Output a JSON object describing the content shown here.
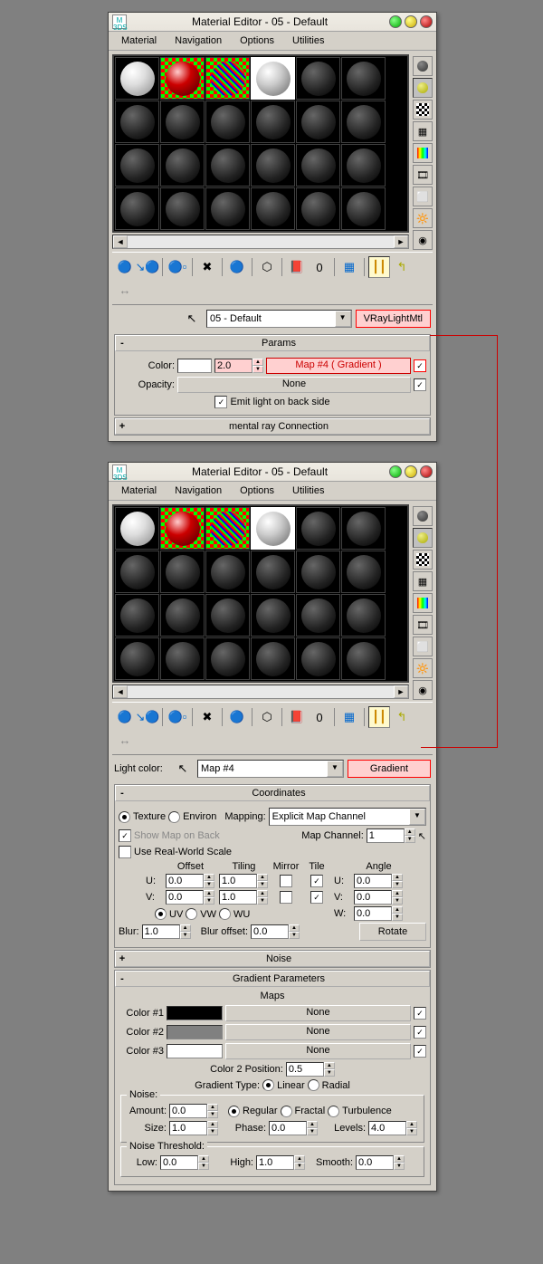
{
  "w1": {
    "title": "Material Editor - 05 - Default",
    "menus": [
      "Material",
      "Navigation",
      "Options",
      "Utilities"
    ],
    "mat_name": "05 - Default",
    "mat_type": "VRayLightMtl",
    "params": {
      "title": "Params",
      "color_lbl": "Color:",
      "intensity": "2.0",
      "map_label": "Map #4  ( Gradient )",
      "opacity_lbl": "Opacity:",
      "opacity_map": "None",
      "emit_label": "Emit light on back side"
    },
    "mray": "mental ray Connection"
  },
  "w2": {
    "title": "Material Editor - 05 - Default",
    "menus": [
      "Material",
      "Navigation",
      "Options",
      "Utilities"
    ],
    "light_color_lbl": "Light color:",
    "map_name": "Map #4",
    "map_type": "Gradient",
    "coords": {
      "title": "Coordinates",
      "texture": "Texture",
      "environ": "Environ",
      "mapping_lbl": "Mapping:",
      "mapping": "Explicit Map Channel",
      "show_map": "Show Map on Back",
      "map_channel_lbl": "Map Channel:",
      "map_channel": "1",
      "real_world": "Use Real-World Scale",
      "hdr_offset": "Offset",
      "hdr_tiling": "Tiling",
      "hdr_mirror": "Mirror",
      "hdr_tile": "Tile",
      "hdr_angle": "Angle",
      "u": "U:",
      "v": "V:",
      "w": "W:",
      "u_off": "0.0",
      "u_til": "1.0",
      "u_ang": "0.0",
      "v_off": "0.0",
      "v_til": "1.0",
      "v_ang": "0.0",
      "w_ang": "0.0",
      "uv": "UV",
      "vw": "VW",
      "wu": "WU",
      "blur_lbl": "Blur:",
      "blur": "1.0",
      "blur_off_lbl": "Blur offset:",
      "blur_off": "0.0",
      "rotate": "Rotate"
    },
    "noise": "Noise",
    "grad": {
      "title": "Gradient Parameters",
      "maps": "Maps",
      "c1": "Color #1",
      "c2": "Color #2",
      "c3": "Color #3",
      "none": "None",
      "c2pos_lbl": "Color 2 Position:",
      "c2pos": "0.5",
      "gtype_lbl": "Gradient Type:",
      "linear": "Linear",
      "radial": "Radial",
      "noise_grp": "Noise:",
      "amount_lbl": "Amount:",
      "amount": "0.0",
      "regular": "Regular",
      "fractal": "Fractal",
      "turb": "Turbulence",
      "size_lbl": "Size:",
      "size": "1.0",
      "phase_lbl": "Phase:",
      "phase": "0.0",
      "levels_lbl": "Levels:",
      "levels": "4.0",
      "thresh_grp": "Noise Threshold:",
      "low_lbl": "Low:",
      "low": "0.0",
      "high_lbl": "High:",
      "high": "1.0",
      "smooth_lbl": "Smooth:",
      "smooth": "0.0"
    }
  }
}
